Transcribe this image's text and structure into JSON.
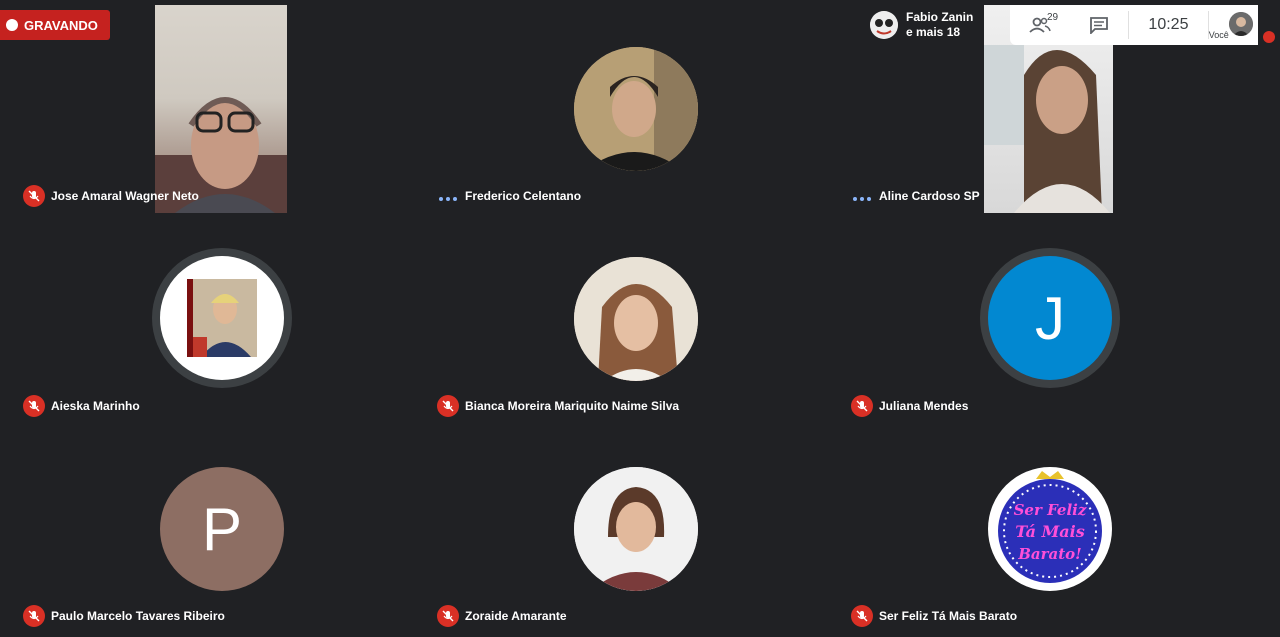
{
  "recording": {
    "label": "GRAVANDO"
  },
  "presenter": {
    "name": "Fabio Zanin",
    "more": "e mais 18"
  },
  "topbar": {
    "participant_count": "29",
    "time": "10:25",
    "self_label": "Você"
  },
  "participants": [
    {
      "name": "Jose Amaral Wagner Neto",
      "status": "muted",
      "kind": "video"
    },
    {
      "name": "Frederico Celentano",
      "status": "speaking",
      "kind": "photo"
    },
    {
      "name": "Aline Cardoso SP",
      "status": "speaking",
      "kind": "video"
    },
    {
      "name": "Aieska Marinho",
      "status": "muted",
      "kind": "photo"
    },
    {
      "name": "Bianca Moreira Mariquito Naime Silva",
      "status": "muted",
      "kind": "photo"
    },
    {
      "name": "Juliana Mendes",
      "status": "muted",
      "kind": "letter",
      "letter": "J",
      "color": "#0288d1"
    },
    {
      "name": "Paulo Marcelo Tavares Ribeiro",
      "status": "muted",
      "kind": "letter",
      "letter": "P",
      "color": "#8d6e63"
    },
    {
      "name": "Zoraide Amarante",
      "status": "muted",
      "kind": "photo"
    },
    {
      "name": "Ser Feliz Tá Mais Barato",
      "status": "muted",
      "kind": "logo",
      "logo_text": [
        "Ser Feliz",
        "Tá Mais",
        "Barato!"
      ]
    }
  ],
  "colors": {
    "muted_red": "#d93025",
    "speaking_dots": "#8ab4f8",
    "tile_bg": "#202124"
  }
}
